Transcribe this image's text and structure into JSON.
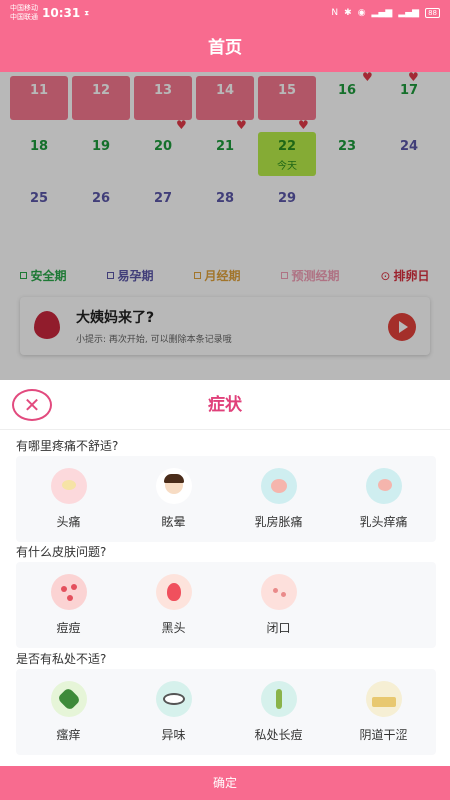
{
  "status_bar": {
    "carrier_1": "中国移动",
    "carrier_2": "中国联通",
    "time": "10:31",
    "icons": [
      "nfc-icon",
      "bluetooth-icon",
      "wifi-icon",
      "signal-icon",
      "signal-icon"
    ],
    "battery": "88"
  },
  "header": {
    "title": "首页"
  },
  "calendar": {
    "rows": [
      [
        {
          "day": "11",
          "type": "period"
        },
        {
          "day": "12",
          "type": "period"
        },
        {
          "day": "13",
          "type": "period"
        },
        {
          "day": "14",
          "type": "period"
        },
        {
          "day": "15",
          "type": "period"
        },
        {
          "day": "16",
          "type": "fertile"
        },
        {
          "day": "17",
          "type": "fertile"
        }
      ],
      [
        {
          "day": "18",
          "type": "fertile"
        },
        {
          "day": "19",
          "type": "fertile"
        },
        {
          "day": "20",
          "type": "fertile"
        },
        {
          "day": "21",
          "type": "fertile"
        },
        {
          "day": "22",
          "type": "today",
          "sub": "今天"
        },
        {
          "day": "23",
          "type": "fertile"
        },
        {
          "day": "24",
          "type": "normal"
        }
      ],
      [
        {
          "day": "25",
          "type": "normal"
        },
        {
          "day": "26",
          "type": "normal"
        },
        {
          "day": "27",
          "type": "normal"
        },
        {
          "day": "28",
          "type": "normal"
        },
        {
          "day": "29",
          "type": "normal"
        }
      ]
    ],
    "legend": [
      {
        "label": "安全期",
        "color": "#2aa84a"
      },
      {
        "label": "易孕期",
        "color": "#5a57a8"
      },
      {
        "label": "月经期",
        "color": "#e0a23c"
      },
      {
        "label": "预测经期",
        "color": "#f3a0b8"
      },
      {
        "label": "排卵日",
        "color": "#d9303f"
      }
    ],
    "colors": {
      "period": "#f5788f",
      "today": "#b9ee4a",
      "fertile": "#1e9b3c",
      "normal": "#5a57a8"
    }
  },
  "promo": {
    "title": "大姨妈来了?",
    "tip": "小提示: 再次开始, 可以删除本条记录哦"
  },
  "sheet": {
    "title": "症状",
    "close_icon": "close-circle-icon",
    "sections": [
      {
        "question": "有哪里疼痛不舒适?",
        "items": [
          {
            "label": "头痛",
            "icon": "headache-icon",
            "color": "#fcd9dc"
          },
          {
            "label": "眩晕",
            "icon": "dizzy-icon",
            "color": "#ffffff"
          },
          {
            "label": "乳房胀痛",
            "icon": "breast-pain-icon",
            "color": "#cfeef0"
          },
          {
            "label": "乳头痒痛",
            "icon": "nipple-itch-icon",
            "color": "#cfeef0"
          }
        ]
      },
      {
        "question": "有什么皮肤问题?",
        "items": [
          {
            "label": "痘痘",
            "icon": "acne-icon",
            "color": "#fbd3d3"
          },
          {
            "label": "黑头",
            "icon": "blackhead-icon",
            "color": "#fde3dc"
          },
          {
            "label": "闭口",
            "icon": "closed-comedone-icon",
            "color": "#fde0dc"
          }
        ]
      },
      {
        "question": "是否有私处不适?",
        "items": [
          {
            "label": "瘙痒",
            "icon": "itch-icon",
            "color": "#e6f5d8"
          },
          {
            "label": "异味",
            "icon": "odor-icon",
            "color": "#d6f1ec"
          },
          {
            "label": "私处长痘",
            "icon": "private-acne-icon",
            "color": "#d6f1ec"
          },
          {
            "label": "阴道干涩",
            "icon": "dryness-icon",
            "color": "#f6efd4"
          }
        ]
      }
    ],
    "confirm_label": "确定"
  },
  "accent": "#f86b8f"
}
